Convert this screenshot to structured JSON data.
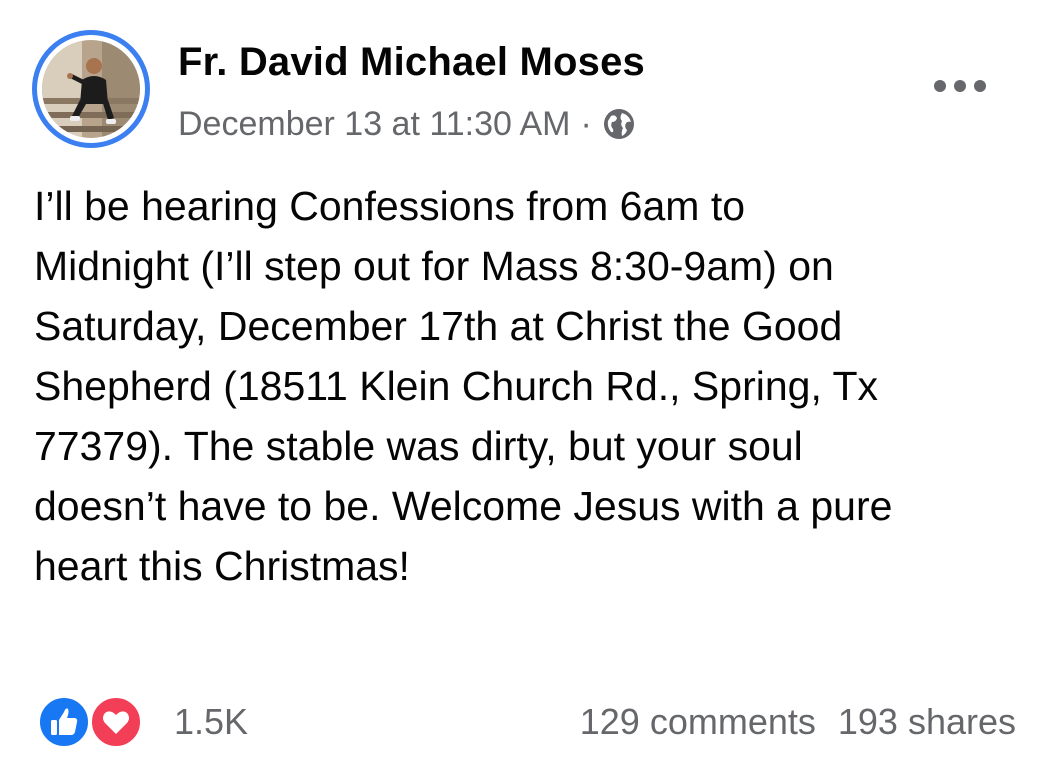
{
  "post": {
    "author": "Fr. David Michael Moses",
    "timestamp": "December 13 at 11:30 AM",
    "separator": "·",
    "audience_icon": "globe-icon",
    "more_icon": "more-options-icon",
    "text_lines": [
      "I’ll be hearing Confessions from 6am to",
      "Midnight (I’ll step out for Mass 8:30-9am) on",
      "Saturday, December 17th at Christ the Good",
      "Shepherd (18511 Klein Church Rd., Spring, Tx",
      "77379). The stable was dirty, but your soul",
      "doesn’t have to be. Welcome Jesus with a pure",
      "heart this Christmas!"
    ]
  },
  "footer": {
    "reaction_icons": [
      "like-icon",
      "love-icon"
    ],
    "reaction_count": "1.5K",
    "comments": "129 comments",
    "shares": "193 shares"
  },
  "colors": {
    "avatar_ring": "#3b7ff0",
    "secondary_text": "#65676b",
    "like_blue": "#1877f2",
    "love_red": "#f33e58"
  }
}
